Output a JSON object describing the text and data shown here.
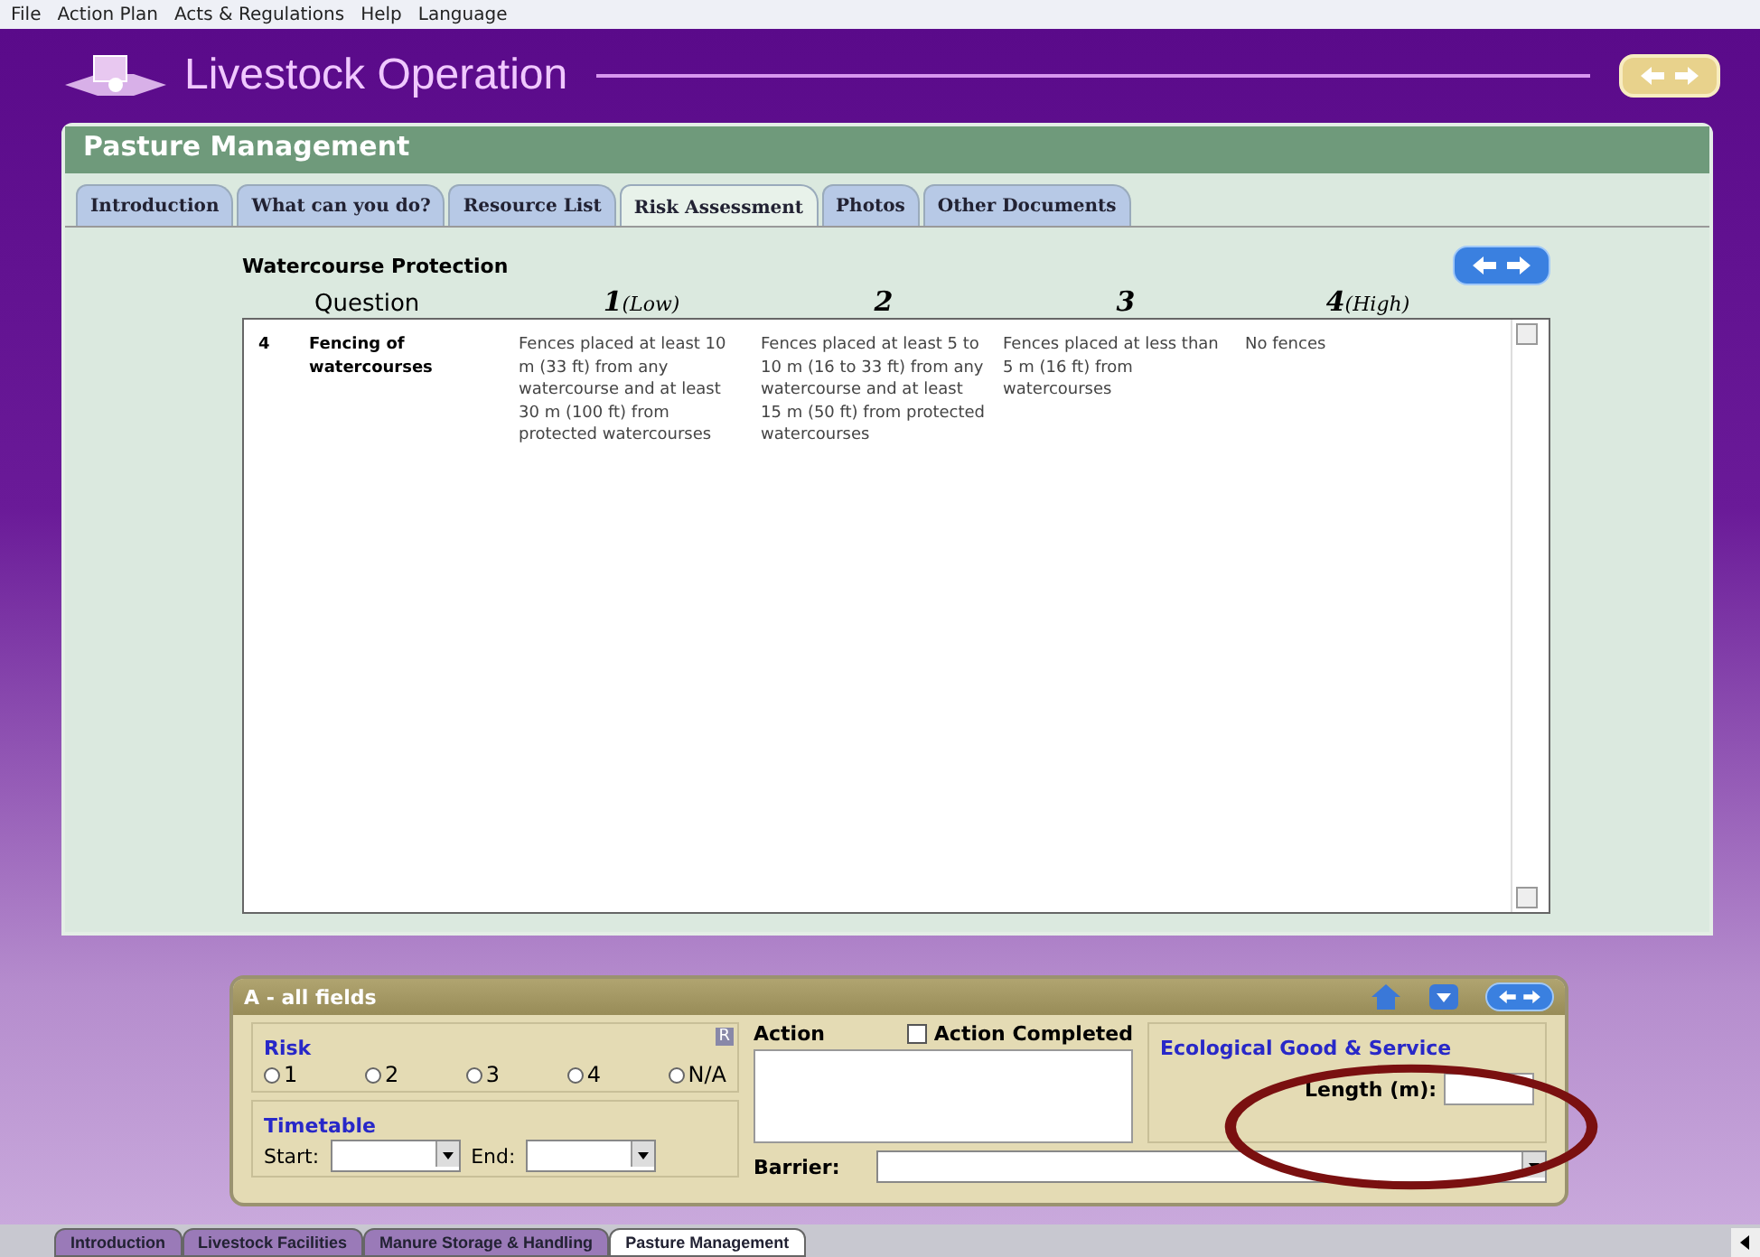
{
  "menu": [
    "File",
    "Action Plan",
    "Acts & Regulations",
    "Help",
    "Language"
  ],
  "app_title": "Livestock Operation",
  "panel": {
    "title": "Pasture Management",
    "tabs": [
      {
        "label": "Introduction",
        "selected": false
      },
      {
        "label": "What can you do?",
        "selected": false
      },
      {
        "label": "Resource List",
        "selected": false
      },
      {
        "label": "Risk Assessment",
        "selected": true
      },
      {
        "label": "Photos",
        "selected": false
      },
      {
        "label": "Other Documents",
        "selected": false
      }
    ],
    "section_title": "Watercourse Protection",
    "columns": [
      {
        "sub": "Question"
      },
      {
        "num": "1",
        "sub": "(Low)"
      },
      {
        "num": "2"
      },
      {
        "num": "3"
      },
      {
        "num": "4",
        "sub": "(High)"
      }
    ],
    "rows": [
      {
        "number": "4",
        "question": "Fencing of watercourses",
        "levels": [
          "Fences placed at least 10 m (33 ft) from any watercourse and at least 30 m (100 ft) from protected watercourses",
          "Fences placed at least 5 to 10 m (16 to 33 ft) from any watercourse and at least 15 m (50 ft) from protected watercourses",
          "Fences placed at less than 5 m (16 ft) from watercourses",
          "No fences"
        ]
      }
    ]
  },
  "form": {
    "title": "A - all fields",
    "risk": {
      "label": "Risk",
      "badge": "R",
      "options": [
        {
          "label": "1",
          "selected": false
        },
        {
          "label": "2",
          "selected": false
        },
        {
          "label": "3",
          "selected": false
        },
        {
          "label": "4",
          "selected": false
        },
        {
          "label": "N/A",
          "selected": false
        }
      ]
    },
    "timetable": {
      "label": "Timetable",
      "start_label": "Start:",
      "end_label": "End:"
    },
    "action_label": "Action",
    "action_completed": {
      "label": "Action Completed",
      "checked": false
    },
    "ecological": {
      "label": "Ecological Good & Service",
      "length_label": "Length (m):"
    },
    "barrier_label": "Barrier:"
  },
  "bottom_tabs": [
    {
      "label": "Introduction",
      "selected": false
    },
    {
      "label": "Livestock Facilities",
      "selected": false
    },
    {
      "label": "Manure Storage & Handling",
      "selected": false
    },
    {
      "label": "Pasture Management",
      "selected": true
    }
  ]
}
